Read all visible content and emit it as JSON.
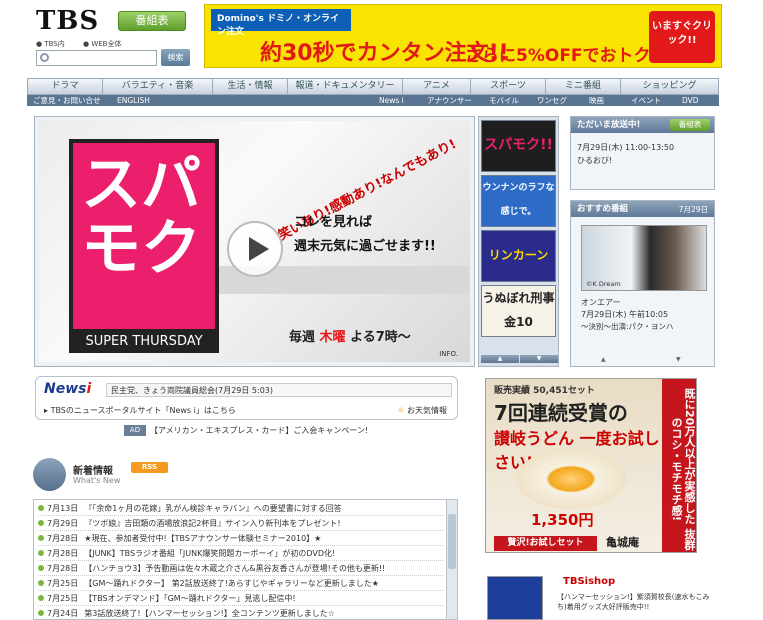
{
  "header": {
    "logo": "TBS",
    "program_button": "番組表",
    "scope_site": "TBS内",
    "scope_web": "WEB全体",
    "search_placeholder": "",
    "search_button": "検索"
  },
  "banner": {
    "logo": "Domino's ドミノ・オンライン注文",
    "line1": "約30秒でカンタン注文!!",
    "line2": "さらに5%OFFでおトク!!",
    "cta": "いますぐクリック!!"
  },
  "nav": {
    "items": [
      "ドラマ",
      "バラエティ・音楽",
      "生活・情報",
      "報道・ドキュメンタリー",
      "アニメ",
      "スポーツ",
      "ミニ番組",
      "ショッピング"
    ]
  },
  "subnav": {
    "left": [
      "ご意見・お問い合せ",
      "ENGLISH"
    ],
    "right": [
      "News i",
      "アナウンサー",
      "モバイル",
      "ワンセグ",
      "映画",
      "イベント",
      "DVD"
    ]
  },
  "hero": {
    "key_text": "スパモク",
    "bar_text": "SUPER THURSDAY",
    "tag": "笑いあり!感動あり!なんでもあり!",
    "duration": "の2時間!",
    "catch1": "コレを見れば",
    "catch2": "週末元気に過ごせます!!",
    "weekly_pre": "毎週",
    "weekly_day": "木曜",
    "weekly_post": "よる7時〜",
    "info": "INFO."
  },
  "thumbs": [
    {
      "label": "スパモク!! SUPER THURSDAY"
    },
    {
      "label": "ウンナンのラフな感じで。"
    },
    {
      "label": "リンカーン"
    },
    {
      "label": "うぬぼれ刑事 金10"
    }
  ],
  "now_onair": {
    "title": "ただいま放送中!",
    "button": "番組表",
    "time": "7月29日(木) 11:00-13:50",
    "program": "ひるおび!"
  },
  "recommend": {
    "title": "おすすめ番組",
    "date": "7月29日",
    "photo_caption": "©K Dream",
    "label": "オンエアー",
    "time": "7月29日(木) 午前10:05",
    "desc": "〜決別〜出演:パク・ヨンハ"
  },
  "newsi": {
    "logo": "News",
    "logo_mark": "i",
    "headline": "民主党、きょう両院議員総会(7月29日 5:03)",
    "link": "TBSのニュースポータルサイト「News i」はこちら",
    "weather": "お天気情報"
  },
  "ad": {
    "badge": "AD",
    "text": "【アメリカン・エキスプレス・カード】ご入会キャンペーン!"
  },
  "new_info": {
    "title": "新着情報",
    "subtitle": "What's New",
    "rss": "RSS",
    "items": [
      {
        "date": "7月13日",
        "text": "『「余命1ヶ月の花嫁」乳がん検診キャラバン』への要望書に対する回答"
      },
      {
        "date": "7月29日",
        "text": "『ツボ娘』吉田類の酒場放浪記2杯目』サイン入り新刊本をプレゼント!"
      },
      {
        "date": "7月28日",
        "text": "★現在、参加者受付中!【TBSアナウンサー体験セミナー2010】★"
      },
      {
        "date": "7月28日",
        "text": "【JUNK】TBSラジオ番組「JUNK爆笑問題カーボーイ」が初のDVD化!"
      },
      {
        "date": "7月28日",
        "text": "【ハンチョウ3】予告動画は佐々木蔵之介さん&黒谷友香さんが登場!その他も更新!!"
      },
      {
        "date": "7月25日",
        "text": "【GM〜踊れドクター】 第2話放送終了!あらすじやギャラリーなど更新しました★"
      },
      {
        "date": "7月25日",
        "text": "【TBSオンデマンド】「GM〜踊れドクター」見逃し配信中!"
      },
      {
        "date": "7月24日",
        "text": "第3話放送終了!【ハンマーセッション!】全コンテンツ更新しました☆"
      }
    ]
  },
  "udon_ad": {
    "small": "販売実績 50,451セット",
    "big": "7回連続受賞の",
    "red": "讃岐うどん 一度お試しください!",
    "side": "既に20万人以上が実感した 抜群のコシ・モチモチ感!",
    "price": "1,350円",
    "try": "贅沢!お試しセット",
    "brand": "亀城庵"
  },
  "shop": {
    "title": "TBSishop",
    "text": "【ハンマーセッション!】紫須賀校長(速水もこみち)着用グッズ大好評販売中!!"
  }
}
